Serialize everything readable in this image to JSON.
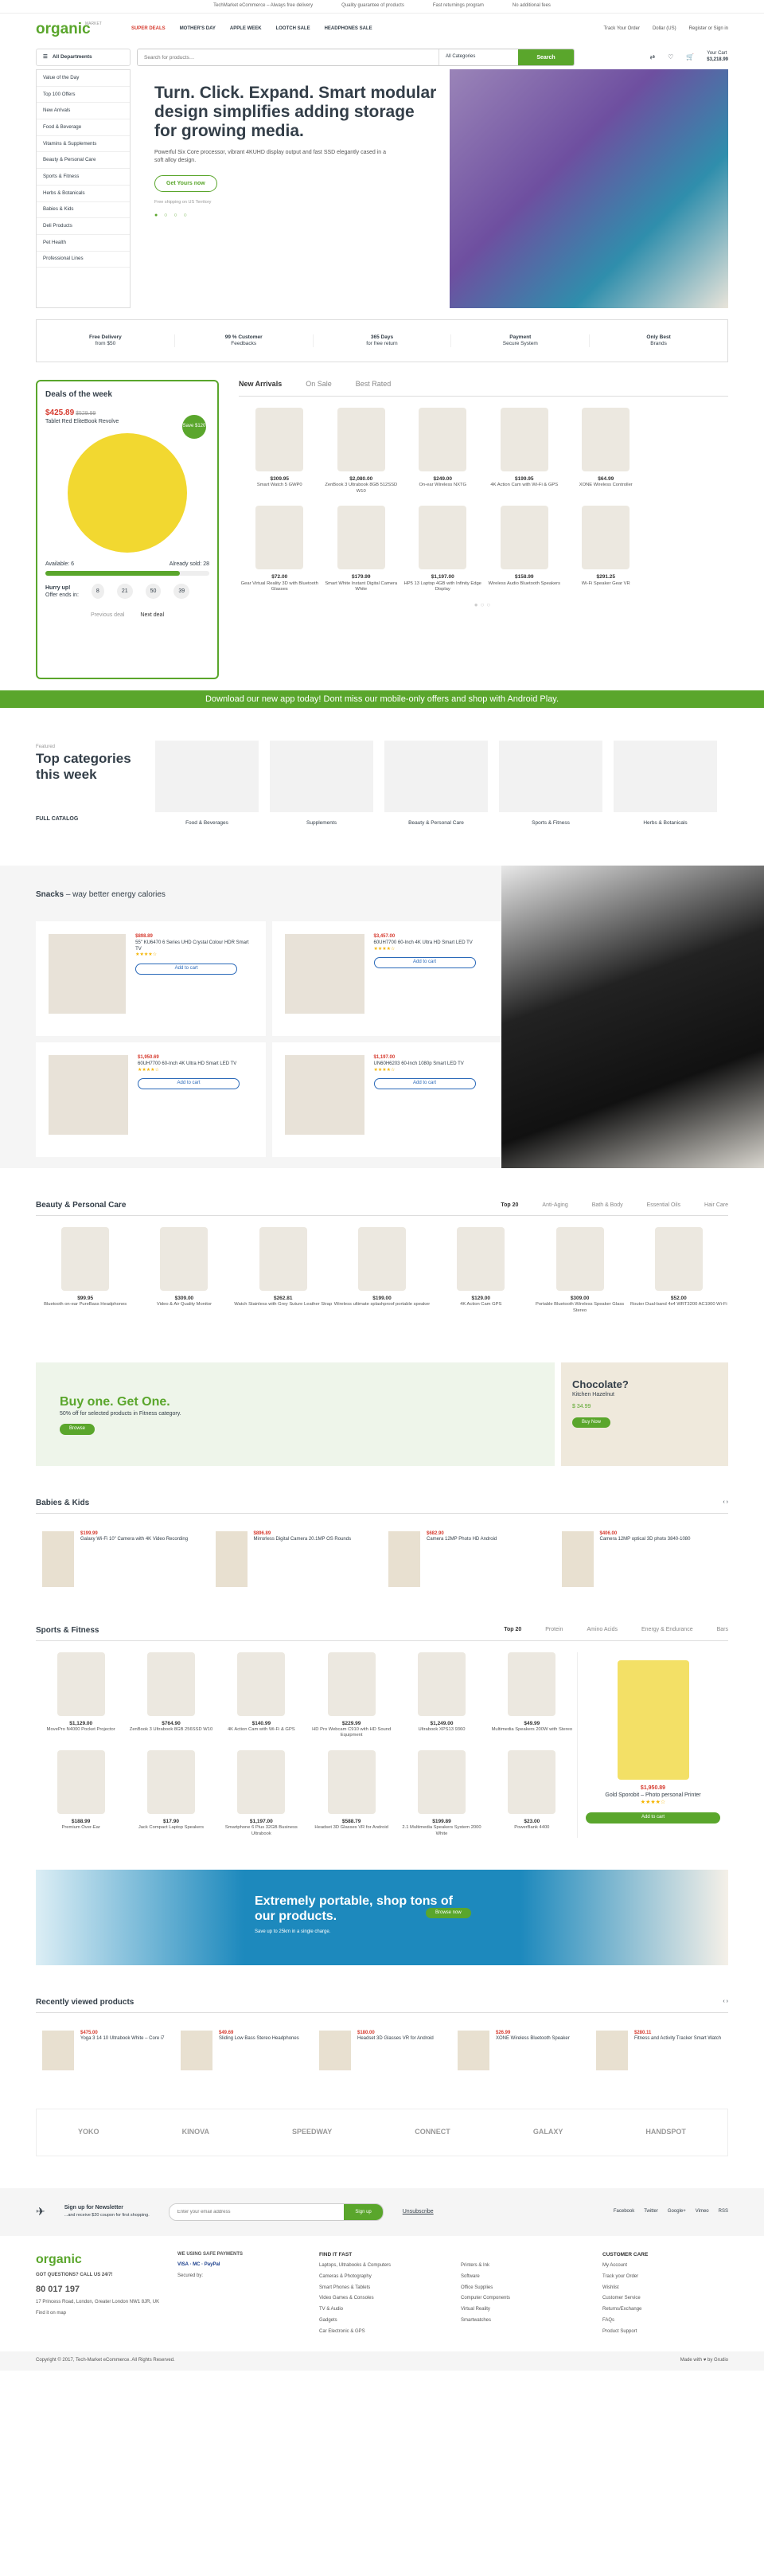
{
  "topbar": [
    "TechMarket eCommerce – Always free delivery",
    "Quality guarantee of products",
    "Fast returnings program",
    "No additional fees"
  ],
  "header": {
    "logo": "organic",
    "logo_sup": "MARKET",
    "deals": [
      "SUPER DEALS",
      "MOTHER'S DAY",
      "APPLE WEEK",
      "LOOTCH SALE",
      "HEADPHONES SALE"
    ],
    "track": "Track Your Order",
    "currency": "Dollar (US)",
    "login": "Register or Sign in",
    "cart_total": "$3,218.99",
    "cart_label": "Your Cart"
  },
  "search": {
    "menu_label": "All Departments",
    "placeholder": "Search for products…",
    "category": "All Categories",
    "button": "Search"
  },
  "sidebar": [
    "Value of the Day",
    "Top 100 Offers",
    "New Arrivals",
    "Food & Beverage",
    "Vitamins & Supplements",
    "Beauty & Personal Care",
    "Sports & Fitness",
    "Herbs & Botanicals",
    "Babies & Kids",
    "Deli Products",
    "Pet Health",
    "Professional Lines"
  ],
  "hero": {
    "title": "Turn. Click. Expand. Smart modular design simplifies adding storage for growing media.",
    "text": "Powerful Six Core processor, vibrant 4KUHD display output and fast SSD elegantly cased in a soft alloy design.",
    "button": "Get Yours now",
    "note": "Free shipping on US Territory"
  },
  "features": [
    {
      "t": "Free Delivery",
      "s": "from $50"
    },
    {
      "t": "99 % Customer",
      "s": "Feedbacks"
    },
    {
      "t": "365 Days",
      "s": "for free return"
    },
    {
      "t": "Payment",
      "s": "Secure System"
    },
    {
      "t": "Only Best",
      "s": "Brands"
    }
  ],
  "deal": {
    "title": "Deals of the week",
    "price": "$425.89",
    "old": "$529.99",
    "name": "Tablet Red EliteBook Revolve",
    "badge": "Save $120",
    "available": "Available: 6",
    "sold": "Already sold: 28",
    "hurry": "Hurry up!",
    "offer": "Offer ends in:",
    "time": [
      "8",
      "21",
      "50",
      "39"
    ],
    "units": [
      "HOURS",
      "MINS",
      "SECS",
      "SECS"
    ],
    "prev": "Previous deal",
    "next": "Next deal"
  },
  "tabs": [
    "New Arrivals",
    "On Sale",
    "Best Rated"
  ],
  "products": [
    {
      "p": "$309.95",
      "n": "Smart Watch 5 GWP0"
    },
    {
      "p": "$2,080.00",
      "n": "ZenBook 3 Ultrabook 8GB 512SSD W10"
    },
    {
      "p": "$249.00",
      "n": "On-ear Wireless NXTG"
    },
    {
      "p": "$199.95",
      "n": "4K Action Cam with Wi-Fi & GPS"
    },
    {
      "p": "$64.99",
      "n": "XONE Wireless Controller"
    },
    {
      "p": "",
      "n": ""
    },
    {
      "p": "$72.00",
      "n": "Gear Virtual Reality 3D with Bluetooth Glasses"
    },
    {
      "p": "$179.99",
      "n": "Smart White Instant Digital Camera White"
    },
    {
      "p": "$1,197.00",
      "n": "HP5 13 Laptop 4GB with Infinity Edge Display"
    },
    {
      "p": "$158.99",
      "n": "Wireless Audio Bluetooth Speakers"
    },
    {
      "p": "$291.25",
      "n": "Wi-Fi Speaker Gear VR"
    }
  ],
  "app_banner": "Download our new app today! Dont miss our mobile-only offers and shop with Android Play.",
  "topcat": {
    "sub": "Featured",
    "title": "Top categories this week",
    "link": "FULL CATALOG",
    "items": [
      "Food & Beverages",
      "Supplements",
      "Beauty & Personal Care",
      "Sports & Fitness",
      "Herbs & Botanicals"
    ]
  },
  "snacks": {
    "title": "Snacks",
    "sub": "– way better energy calories",
    "cards": [
      {
        "p": "$898.89",
        "n": "55\" KU6470 6 Series UHD Crystal Colour HDR Smart TV"
      },
      {
        "p": "$3,457.00",
        "n": "60UH7700 60-Inch 4K Ultra HD Smart LED TV"
      },
      {
        "p": "$1,950.69",
        "n": "60UH7700 60-Inch 4K Ultra HD Smart LED TV"
      },
      {
        "p": "$1,197.00",
        "n": "UN60H6203 60-Inch 1080p Smart LED TV"
      }
    ],
    "cart": "Add to cart"
  },
  "beauty": {
    "title": "Beauty & Personal Care",
    "tabs": [
      "Top 20",
      "Anti-Aging",
      "Bath & Body",
      "Essential Oils",
      "Hair Care"
    ],
    "items": [
      {
        "p": "$99.95",
        "n": "Bluetooth on-ear PureBass Headphones"
      },
      {
        "p": "$309.00",
        "n": "Video & Air Quality Monitor"
      },
      {
        "p": "$262.81",
        "n": "Watch Stainless with Grey Suture Leather Strap"
      },
      {
        "p": "$199.00",
        "n": "Wireless ultimate splashproof portable speaker"
      },
      {
        "p": "$129.00",
        "n": "4K Action Cam GPS"
      },
      {
        "p": "$309.00",
        "n": "Portable Bluetooth Wireless Speaker Glass Stereo"
      },
      {
        "p": "$52.00",
        "n": "Router Dual-band 4x4 WRT3200 AC1900 Wi-Fi"
      }
    ]
  },
  "promo": {
    "title": "Buy one. Get One.",
    "sub": "50% off for selected products in Fitness category.",
    "button": "Browse",
    "choc_title": "Chocolate?",
    "choc_sub": "Kitchen Hazelnut",
    "choc_price": "$ 34.99",
    "choc_btn": "Buy Now"
  },
  "babies": {
    "title": "Babies & Kids",
    "items": [
      {
        "p": "$199.99",
        "n": "Galaxy Wi-Fi 10\" Camera with 4K Video Recording"
      },
      {
        "p": "$896.89",
        "n": "Mirrorless Digital Camera 20.1MP OS Rounds"
      },
      {
        "p": "$682.90",
        "n": "Camera 12MP Photo HD Android"
      },
      {
        "p": "$406.00",
        "n": "Camera 12MP optical 3D photo 3840-1080"
      }
    ]
  },
  "sports": {
    "title": "Sports & Fitness",
    "tabs": [
      "Top 20",
      "Protein",
      "Amino Acids",
      "Energy & Endurance",
      "Bars"
    ],
    "items": [
      {
        "p": "$1,129.00",
        "n": "MovePro N4000 Pocket Projector"
      },
      {
        "p": "$764.90",
        "n": "ZenBook 3 Ultrabook 8GB 256SSD W10"
      },
      {
        "p": "$140.99",
        "n": "4K Action Cam with Wi-Fi & GPS"
      },
      {
        "p": "$229.99",
        "n": "HD Pro Webcam C910 with HD Sound Equipment"
      },
      {
        "p": "$1,249.00",
        "n": "Ultrabook XPS13 9360"
      },
      {
        "p": "$49.99",
        "n": "Multimedia Speakers 200W with Stereo"
      },
      {
        "p": "$188.99",
        "n": "Premium Over-Ear"
      },
      {
        "p": "$17.90",
        "n": "Jack Compact Laptop Speakers"
      },
      {
        "p": "$1,197.00",
        "n": "Smartphone 6 Plus 32GB Business Ultrabook"
      },
      {
        "p": "$588.79",
        "n": "Headset 3D Glasses VR for Android"
      },
      {
        "p": "$199.89",
        "n": "2.1 Multimedia Speakers System 2000 White"
      },
      {
        "p": "$23.00",
        "n": "PowerBank 4400"
      }
    ],
    "featured": {
      "p": "$1,950.89",
      "n": "Gold Sporobit – Photo personal Printer",
      "cart": "Add to cart"
    }
  },
  "blue": {
    "title": "Extremely portable, shop tons of our products.",
    "sub": "Save up to 25km in a single charge.",
    "button": "Browse now"
  },
  "recent": {
    "title": "Recently viewed products",
    "items": [
      {
        "p": "$475.00",
        "n": "Yoga 3 14 10 Ultrabook White – Core i7"
      },
      {
        "p": "$49.69",
        "n": "Sliding Low Bass Stereo Headphones"
      },
      {
        "p": "$180.00",
        "n": "Headset 3D Glasses VR for Android"
      },
      {
        "p": "$26.99",
        "n": "XONE Wireless Bluetooth Speaker"
      },
      {
        "p": "$280.11",
        "n": "Fitness and Activity Tracker Smart Watch"
      }
    ]
  },
  "brands": [
    "YOKO",
    "KINOVA",
    "SPEEDWAY",
    "CONNECT",
    "GALAXY",
    "HANDSPOT"
  ],
  "newsletter": {
    "title": "Sign up for Newsletter",
    "sub": "...and receive $20 coupon for first shopping.",
    "placeholder": "Enter your email address",
    "button": "Sign up",
    "unsub": "Unsubscribe",
    "social": [
      "Facebook",
      "Twitter",
      "Google+",
      "Vimeo",
      "RSS"
    ]
  },
  "footer": {
    "q": "GOT QUESTIONS? CALL US 24/7!",
    "phone": "80 017 197",
    "address": "17 Princess Road, London, Greater London NW1 8JR, UK",
    "find": "Find it on map",
    "pay": "WE USING SAFE PAYMENTS",
    "secured": "Secured by:",
    "fast_title": "FIND IT FAST",
    "fast": [
      "Laptops, Ultrabooks & Computers",
      "Cameras & Photography",
      "Smart Phones & Tablets",
      "Video Games & Consoles",
      "TV & Audio",
      "Gadgets",
      "Car Electronic & GPS"
    ],
    "col2": [
      "Printers & Ink",
      "Software",
      "Office Supplies",
      "Computer Components",
      "Virtual Reality",
      "Smartwatches"
    ],
    "care_title": "CUSTOMER CARE",
    "care": [
      "My Account",
      "Track your Order",
      "Wishlist",
      "Customer Service",
      "Returns/Exchange",
      "FAQs",
      "Product Support"
    ]
  },
  "copyright": {
    "left": "Copyright © 2017, Tech-Market eCommerce. All Rights Reserved.",
    "right": "Made with ♥ by Grudio"
  }
}
